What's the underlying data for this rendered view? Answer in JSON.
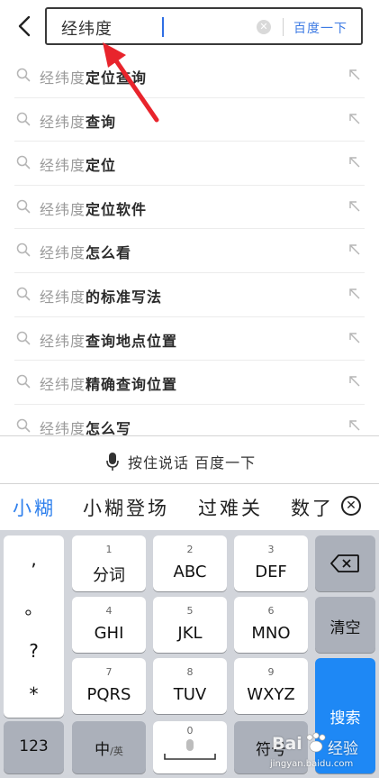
{
  "search": {
    "query": "经纬度",
    "submit_label": "百度一下"
  },
  "suggestions": [
    {
      "prefix": "经纬度",
      "suffix": "定位查询"
    },
    {
      "prefix": "经纬度",
      "suffix": "查询"
    },
    {
      "prefix": "经纬度",
      "suffix": "定位"
    },
    {
      "prefix": "经纬度",
      "suffix": "定位软件"
    },
    {
      "prefix": "经纬度",
      "suffix": "怎么看"
    },
    {
      "prefix": "经纬度",
      "suffix": "的标准写法"
    },
    {
      "prefix": "经纬度",
      "suffix": "查询地点位置"
    },
    {
      "prefix": "经纬度",
      "suffix": "精确查询位置"
    },
    {
      "prefix": "经纬度",
      "suffix": "怎么写"
    }
  ],
  "voice_bar": {
    "label": "按住说话 百度一下"
  },
  "candidates": [
    "小糊",
    "小糊登场",
    "过难关",
    "数了"
  ],
  "keyboard": {
    "punctuation": [
      ",",
      "。",
      "?",
      "*"
    ],
    "keys": [
      {
        "num": "1",
        "label": "分词"
      },
      {
        "num": "2",
        "label": "ABC"
      },
      {
        "num": "3",
        "label": "DEF"
      },
      {
        "num": "4",
        "label": "GHI"
      },
      {
        "num": "5",
        "label": "JKL"
      },
      {
        "num": "6",
        "label": "MNO"
      },
      {
        "num": "7",
        "label": "PQRS"
      },
      {
        "num": "8",
        "label": "TUV"
      },
      {
        "num": "9",
        "label": "WXYZ"
      }
    ],
    "clear_label": "清空",
    "search_label": "搜索",
    "num_label": "123",
    "lang_main": "中",
    "lang_sub": "/英",
    "space_num": "0",
    "symbol_label": "符号"
  },
  "watermark": {
    "brand": "Bai",
    "brand_tail": "经验",
    "url": "jingyan.baidu.com"
  },
  "colors": {
    "accent": "#2f80ed",
    "search_key": "#1e88f5",
    "arrow": "#e8242c"
  }
}
